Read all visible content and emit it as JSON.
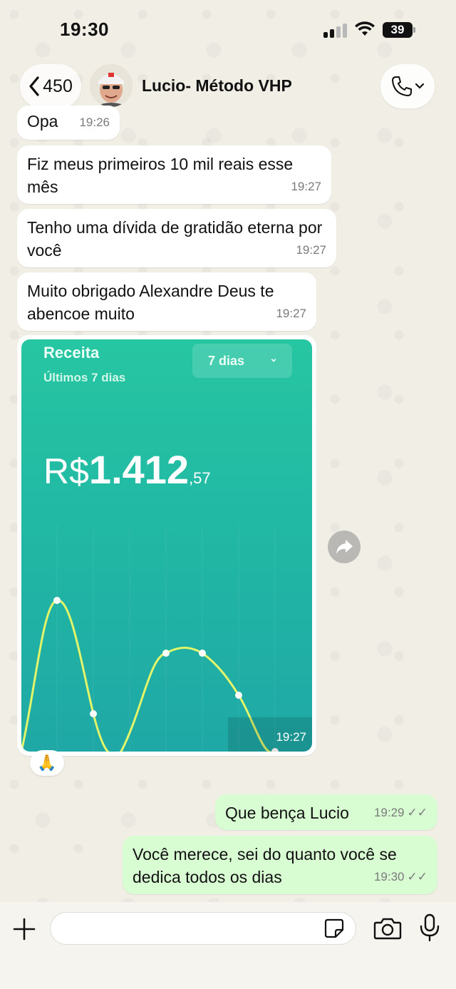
{
  "status_bar": {
    "time": "19:30",
    "battery": "39",
    "battery_level": 0.39
  },
  "header": {
    "back_count": "450",
    "contact_name": "Lucio- Método VHP"
  },
  "messages": [
    {
      "direction": "in",
      "text": "Opa",
      "time": "19:26"
    },
    {
      "direction": "in",
      "text": "Fiz meus primeiros 10 mil reais esse mês",
      "time": "19:27"
    },
    {
      "direction": "in",
      "text": "Tenho uma dívida de gratidão eterna por você",
      "time": "19:27"
    },
    {
      "direction": "in",
      "text": "Muito obrigado Alexandre Deus te abencoe muito",
      "time": "19:27"
    },
    {
      "direction": "out",
      "text": "Que bença Lucio",
      "time": "19:29",
      "read": true
    },
    {
      "direction": "out",
      "text": "Você merece, sei do quanto você se dedica todos os dias",
      "time": "19:30",
      "read": true
    }
  ],
  "image_message": {
    "time": "19:27",
    "reaction": "🙏",
    "card": {
      "title": "Receita",
      "subtitle": "Últimos 7 dias",
      "range_selector": "7 dias",
      "currency": "R$",
      "amount_int": "1.412",
      "amount_cents": ",57",
      "colors": {
        "top": "#27c6a2",
        "bottom": "#1fa8a6",
        "line": "#e2f56a"
      }
    }
  },
  "input_bar": {
    "placeholder": ""
  },
  "colors": {
    "outgoing_bubble": "#d9fdd3",
    "incoming_bubble": "#ffffff",
    "background": "#f1eee6"
  }
}
